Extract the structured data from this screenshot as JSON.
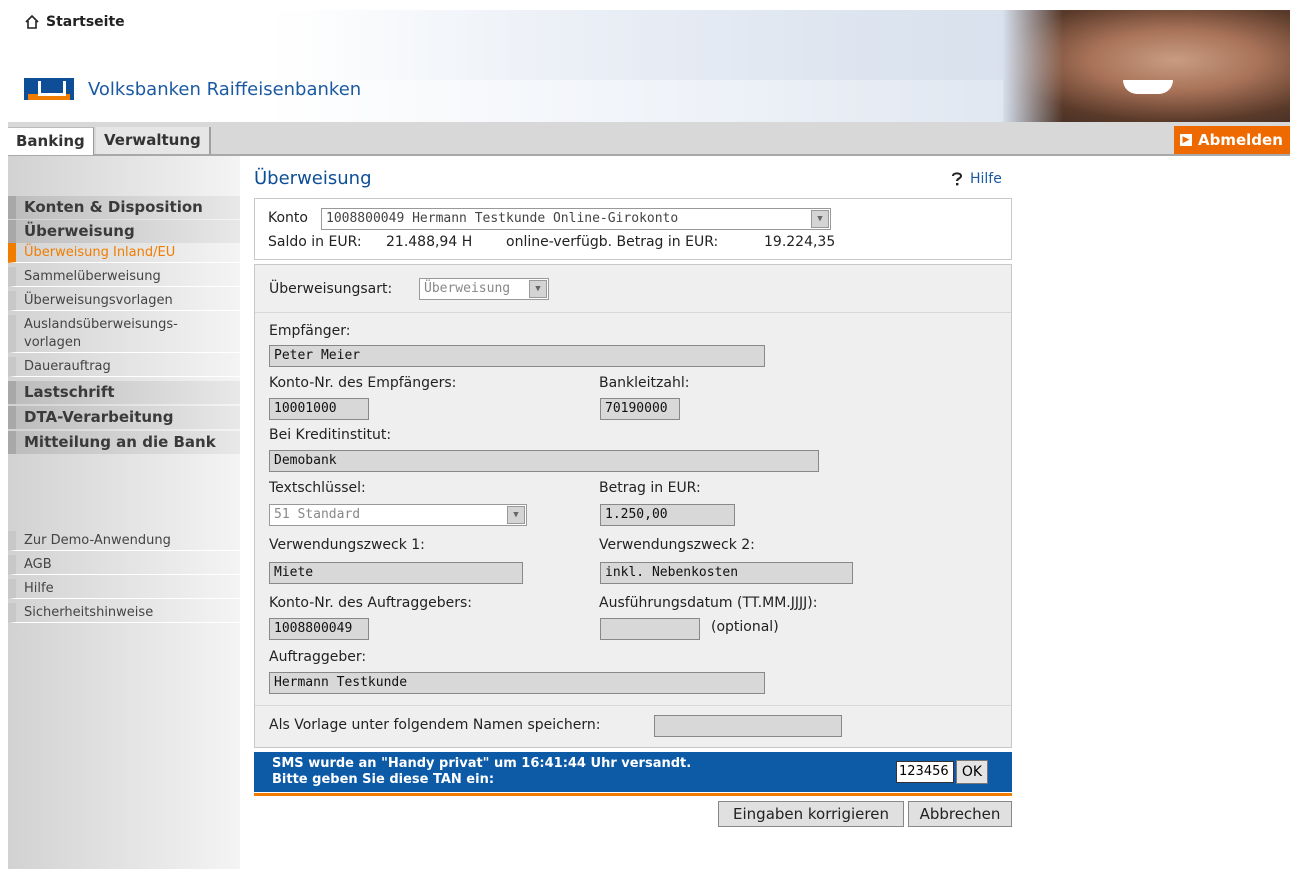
{
  "header": {
    "home_label": "Startseite",
    "bank_name": "Volksbanken Raiffeisenbanken"
  },
  "nav": {
    "tabs": [
      {
        "label": "Banking",
        "active": true
      },
      {
        "label": "Verwaltung",
        "active": false
      }
    ],
    "logout_label": "Abmelden"
  },
  "sidebar": {
    "items": [
      {
        "label": "Konten & Disposition",
        "type": "heading"
      },
      {
        "label": "Überweisung",
        "type": "heading"
      },
      {
        "label": "Überweisung Inland/EU",
        "type": "sub",
        "active": true
      },
      {
        "label": "Sammelüberweisung",
        "type": "sub"
      },
      {
        "label": "Überweisungsvorlagen",
        "type": "sub"
      },
      {
        "label": "Auslandsüberweisungs-",
        "type": "sub"
      },
      {
        "label": "vorlagen",
        "type": "sub"
      },
      {
        "label": "Dauerauftrag",
        "type": "sub"
      },
      {
        "label": "Lastschrift",
        "type": "heading"
      },
      {
        "label": "DTA-Verarbeitung",
        "type": "heading"
      },
      {
        "label": "Mitteilung an die Bank",
        "type": "heading"
      }
    ],
    "links": [
      "Zur Demo-Anwendung",
      "AGB",
      "Hilfe",
      "Sicherheitshinweise"
    ]
  },
  "main": {
    "title": "Überweisung",
    "help_label": "Hilfe",
    "konto": {
      "label": "Konto",
      "selected": "1008800049  Hermann Testkunde  Online-Girokonto",
      "saldo_label": "Saldo in EUR:",
      "saldo_value": "21.488,94 H",
      "verfuegbar_label": "online-verfügb. Betrag in EUR:",
      "verfuegbar_value": "19.224,35"
    },
    "form": {
      "art_label": "Überweisungsart:",
      "art_value": "Überweisung",
      "empfaenger_label": "Empfänger:",
      "empfaenger_value": "Peter Meier",
      "kontonr_label": "Konto-Nr. des Empfängers:",
      "kontonr_value": "10001000",
      "blz_label": "Bankleitzahl:",
      "blz_value": "70190000",
      "kreditinstitut_label": "Bei Kreditinstitut:",
      "kreditinstitut_value": "Demobank",
      "textschluessel_label": "Textschlüssel:",
      "textschluessel_value": "51 Standard",
      "betrag_label": "Betrag in EUR:",
      "betrag_value": "1.250,00",
      "zweck1_label": "Verwendungszweck 1:",
      "zweck1_value": "Miete",
      "zweck2_label": "Verwendungszweck 2:",
      "zweck2_value": "inkl. Nebenkosten",
      "auftraggeber_konto_label": "Konto-Nr. des Auftraggebers:",
      "auftraggeber_konto_value": "1008800049",
      "datum_label": "Ausführungsdatum (TT.MM.JJJJ):",
      "datum_value": "",
      "datum_hint": "(optional)",
      "auftraggeber_label": "Auftraggeber:",
      "auftraggeber_value": "Hermann Testkunde",
      "vorlage_label": "Als Vorlage unter folgendem Namen speichern:",
      "vorlage_value": ""
    },
    "sms": {
      "line1": "SMS wurde an \"Handy privat\" um 16:41:44 Uhr versandt.",
      "line2": "Bitte geben Sie diese TAN ein:",
      "tan_value": "123456",
      "ok_label": "OK"
    },
    "buttons": {
      "korrigieren": "Eingaben korrigieren",
      "abbrechen": "Abbrechen"
    }
  },
  "colors": {
    "brand_blue": "#0d4e97",
    "accent_orange": "#f07d00"
  }
}
